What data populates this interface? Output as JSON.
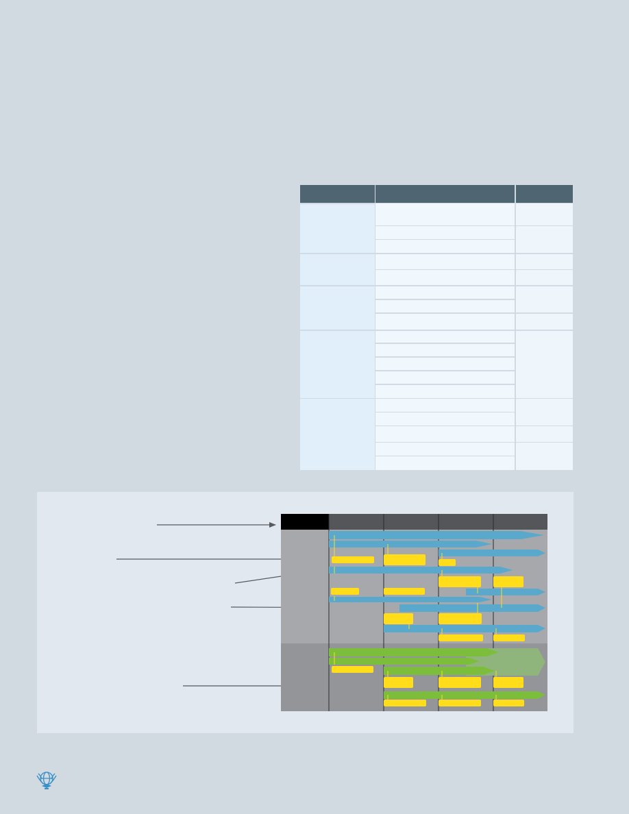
{
  "page": {
    "background": "#d1d9e1"
  },
  "table": {
    "header_color": "#4f6672",
    "group_cell_color": "#e0eff9",
    "item_cell_color": "#f1f8fd",
    "right_cell_color": "#eef6fc"
  },
  "diagram": {
    "panel_color": "#e1e8ef",
    "colors": {
      "header_black": "#000000",
      "header_dark": "#545659",
      "upper_zone": "#a6a8ac",
      "lower_zone": "#939598",
      "blue_bar": "#5aa9cd",
      "green_bar": "#7dbd3c",
      "green_faded": "#8fb47c",
      "yellow_box": "#ffdd1a",
      "arrow": "#57595c"
    }
  },
  "logo": {
    "icon": "organization-emblem-icon",
    "color": "#3a8fc7"
  }
}
